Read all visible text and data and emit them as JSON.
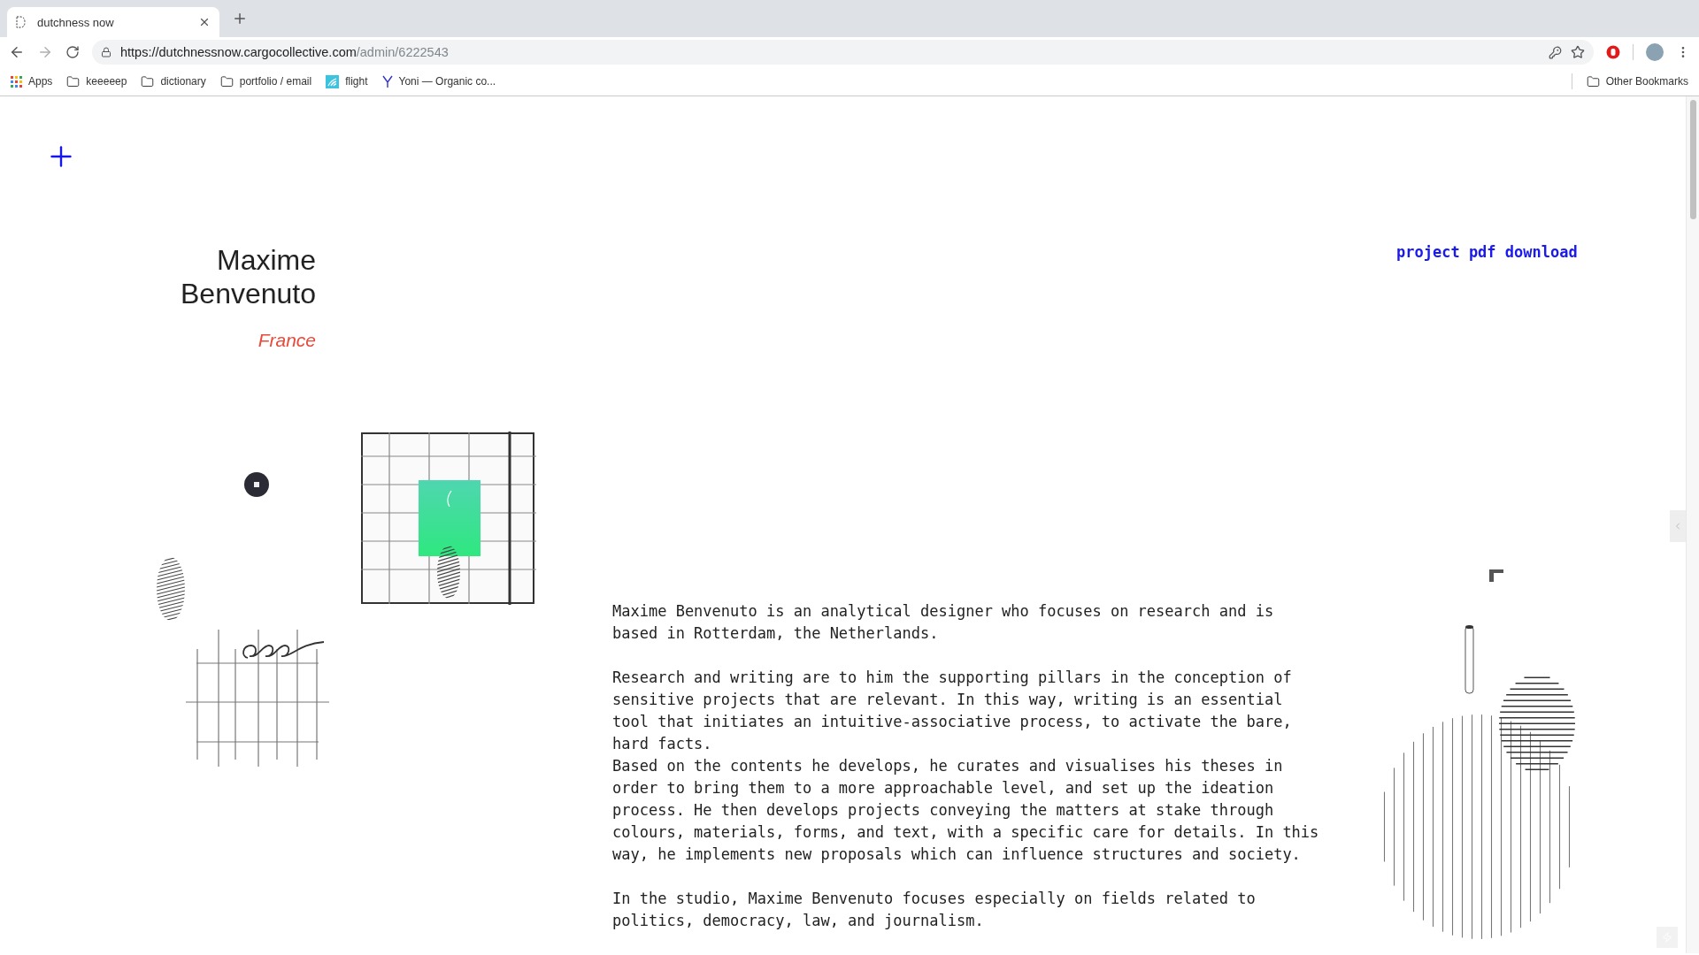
{
  "browser": {
    "tab_title": "dutchness now",
    "url_host": "https://dutchnessnow.cargocollective.com",
    "url_path": "/admin/6222543",
    "bookmarks": [
      {
        "kind": "apps",
        "label": "Apps"
      },
      {
        "kind": "folder",
        "label": "keeeeep"
      },
      {
        "kind": "folder",
        "label": "dictionary"
      },
      {
        "kind": "folder",
        "label": "portfolio / email"
      },
      {
        "kind": "site",
        "label": "flight"
      },
      {
        "kind": "letter",
        "label": "Yoni — Organic co..."
      }
    ],
    "other_bookmarks": "Other Bookmarks"
  },
  "page": {
    "name": "Maxime Benvenuto",
    "country": "France",
    "link": "project pdf download",
    "text_blocks": [
      [
        "Maxime Benvenuto is an analytical designer who focuses on research and is based in Rotterdam, the Netherlands."
      ],
      [
        "Research and writing are to him the supporting pillars in the conception of sensitive projects that are relevant. In this way, writing is an essential tool that initiates an intuitive-associative process, to activate the bare, hard facts.",
        "Based on the contents he develops, he curates and visualises his theses in order to bring them to a more approachable level, and set up the ideation process. He then develops projects conveying the matters at stake through colours, materials, forms, and text, with a specific care for details. In this way, he implements new proposals which can influence structures and society."
      ],
      [
        "In the studio, Maxime Benvenuto focuses especially on fields related to politics, democracy, law, and journalism."
      ]
    ]
  }
}
